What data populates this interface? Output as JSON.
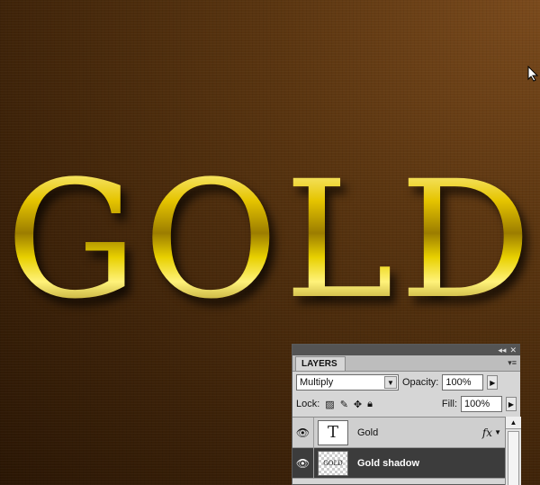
{
  "canvas": {
    "text": "GOLD"
  },
  "panel": {
    "title_tab": "LAYERS",
    "blend_mode": "Multiply",
    "opacity_label": "Opacity:",
    "opacity_value": "100%",
    "lock_label": "Lock:",
    "fill_label": "Fill:",
    "fill_value": "100%",
    "layers": [
      {
        "name": "Gold",
        "thumb": "T",
        "fx": "fx",
        "selected": false
      },
      {
        "name": "Gold shadow",
        "thumb": "GOLD",
        "selected": true
      }
    ]
  },
  "icons": [
    "cursor-icon",
    "collapse-icon",
    "close-icon",
    "panel-menu-icon",
    "dropdown-arrow-icon",
    "eye-icon",
    "lock-transparent-icon",
    "brush-icon",
    "move-icon",
    "lock-icon",
    "fx-icon",
    "scroll-up-icon"
  ],
  "colors": {
    "background": "#5a3510",
    "gold": "#e5c400",
    "selected_layer": "#3c3c3c"
  }
}
